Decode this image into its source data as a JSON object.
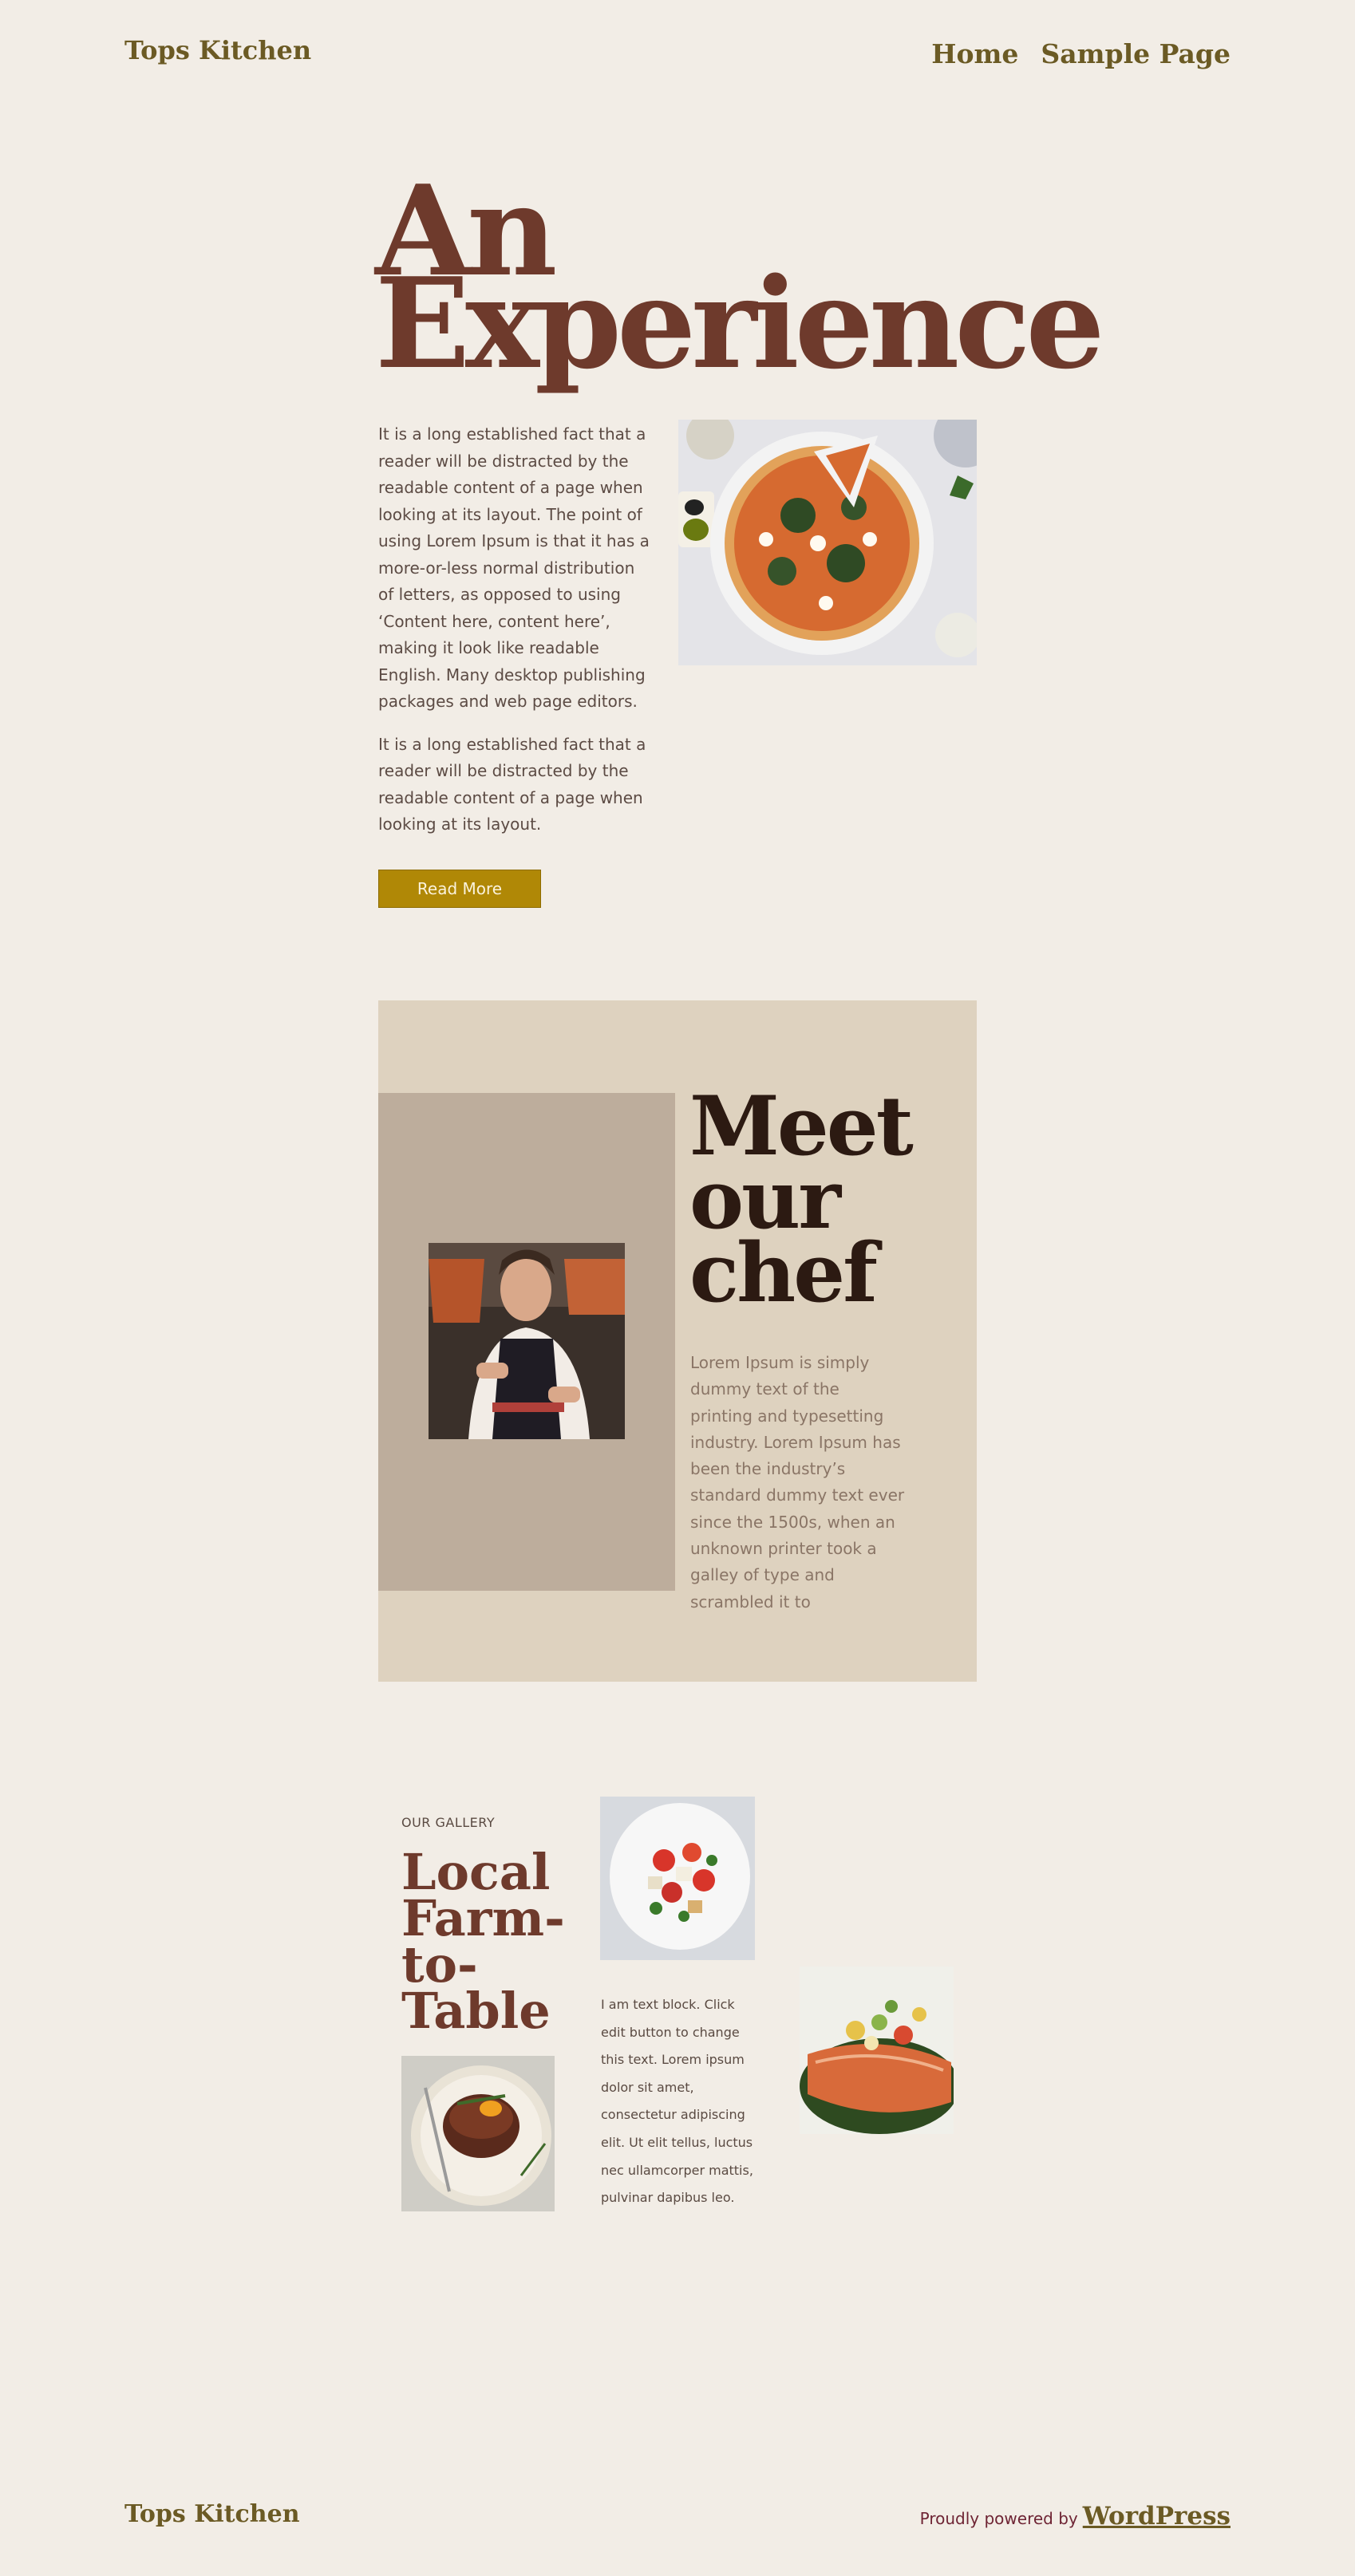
{
  "header": {
    "site_title": "Tops Kitchen",
    "nav": [
      {
        "label": "Home"
      },
      {
        "label": "Sample Page"
      }
    ]
  },
  "hero": {
    "title_line1": "An",
    "title_line2": "Experience",
    "paragraph1": "It is a long established fact that a reader will be distracted by the readable content of a page when looking at its layout. The point of using Lorem Ipsum is that it has a more-or-less normal distribution of letters, as opposed to using ‘Content here, content here’, making it look like readable English. Many desktop publishing packages and web page editors.",
    "paragraph2": "It is a long established fact that a reader will be distracted by the readable content of a page when looking at its layout.",
    "button_label": "Read More",
    "image": "pizza-photo"
  },
  "chef": {
    "title_line1": "Meet",
    "title_line2": "our",
    "title_line3": "chef",
    "text": "Lorem Ipsum is simply dummy text of the printing and typesetting industry. Lorem Ipsum has been the industry’s standard dummy text ever since the 1500s, when an unknown printer took a galley of type and scrambled it to",
    "image": "chef-photo"
  },
  "gallery": {
    "label": "OUR GALLERY",
    "title_line1": "Local",
    "title_line2": "Farm-",
    "title_line3": "to-",
    "title_line4": "Table",
    "text": "I am text block. Click edit button to change this text. Lorem ipsum dolor sit amet, consectetur adipiscing elit. Ut elit tellus, luctus nec ullamcorper mattis, pulvinar dapibus leo.",
    "images": [
      "steak-photo",
      "salad-photo",
      "salmon-photo"
    ]
  },
  "footer": {
    "site_title": "Tops Kitchen",
    "powered_prefix": "Proudly powered by",
    "powered_link": "WordPress"
  },
  "colors": {
    "background": "#f2ede6",
    "brand": "#6b5a24",
    "heading": "#6e3a2c",
    "button": "#b08806",
    "chef_panel": "#ded2bf",
    "chef_inner": "#bdad9c"
  }
}
